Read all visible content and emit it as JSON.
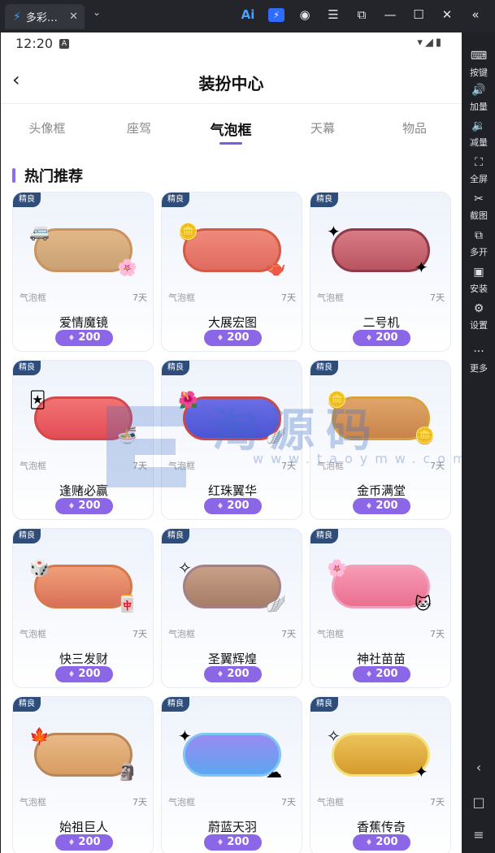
{
  "window": {
    "tab_title": "多彩…",
    "tab_close": "✕",
    "chevron": "⌄",
    "toolbar_icons": [
      "ai-icon",
      "bolt-icon",
      "user-icon",
      "menu-icon",
      "popout-icon",
      "minimize-icon",
      "maximize-icon",
      "close-icon",
      "collapse-icon"
    ]
  },
  "sidebar": {
    "items": [
      {
        "label": "按键",
        "icon": "keyboard-icon",
        "glyph": "⌨"
      },
      {
        "label": "加量",
        "icon": "volume-up-icon",
        "glyph": "🔊"
      },
      {
        "label": "减量",
        "icon": "volume-down-icon",
        "glyph": "🔉"
      },
      {
        "label": "全屏",
        "icon": "fullscreen-icon",
        "glyph": "⛶"
      },
      {
        "label": "截图",
        "icon": "scissors-icon",
        "glyph": "✂"
      },
      {
        "label": "多开",
        "icon": "multi-open-icon",
        "glyph": "⧉"
      },
      {
        "label": "安装",
        "icon": "apk-install-icon",
        "glyph": "▣"
      },
      {
        "label": "设置",
        "icon": "settings-icon",
        "glyph": "⚙"
      },
      {
        "label": "更多",
        "icon": "more-icon",
        "glyph": "···"
      }
    ]
  },
  "status": {
    "time": "12:20",
    "a": "A"
  },
  "appbar": {
    "title": "装扮中心",
    "back": "‹"
  },
  "tabs": [
    "头像框",
    "座驾",
    "气泡框",
    "天幕",
    "物品"
  ],
  "active_tab": 2,
  "section_title": "热门推荐",
  "cards": [
    {
      "badge": "精良",
      "kind": "气泡框",
      "days": "7天",
      "name": "爱情魔镜",
      "price": "200",
      "colors": [
        "#e2b788",
        "#c9a173"
      ],
      "border": "#c9925f"
    },
    {
      "badge": "精良",
      "kind": "气泡框",
      "days": "7天",
      "name": "大展宏图",
      "price": "200",
      "colors": [
        "#f08a7a",
        "#e06a60"
      ],
      "border": "#d45a45"
    },
    {
      "badge": "精良",
      "kind": "气泡框",
      "days": "7天",
      "name": "二号机",
      "price": "200",
      "colors": [
        "#d97b86",
        "#b9545f"
      ],
      "border": "#8f3a47"
    },
    {
      "badge": "精良",
      "kind": "气泡框",
      "days": "7天",
      "name": "逢赌必赢",
      "price": "200",
      "colors": [
        "#f27373",
        "#e24d55"
      ],
      "border": "#d44a4a"
    },
    {
      "badge": "精良",
      "kind": "气泡框",
      "days": "7天",
      "name": "红珠翼华",
      "price": "200",
      "colors": [
        "#6a6ee6",
        "#4b55d3"
      ],
      "border": "#c84a4a"
    },
    {
      "badge": "精良",
      "kind": "气泡框",
      "days": "7天",
      "name": "金币满堂",
      "price": "200",
      "colors": [
        "#e0a56a",
        "#c9844a"
      ],
      "border": "#d6a040"
    },
    {
      "badge": "精良",
      "kind": "气泡框",
      "days": "7天",
      "name": "快三发财",
      "price": "200",
      "colors": [
        "#f0a078",
        "#d9705a"
      ],
      "border": "#d47a48"
    },
    {
      "badge": "精良",
      "kind": "气泡框",
      "days": "7天",
      "name": "圣翼辉煌",
      "price": "200",
      "colors": [
        "#c8a088",
        "#a67d66"
      ],
      "border": "#a48088"
    },
    {
      "badge": "精良",
      "kind": "气泡框",
      "days": "7天",
      "name": "神社苗苗",
      "price": "200",
      "colors": [
        "#f79ab3",
        "#ea6f90"
      ],
      "border": "#f0a0b8"
    },
    {
      "badge": "精良",
      "kind": "气泡框",
      "days": "7天",
      "name": "始祖巨人",
      "price": "200",
      "colors": [
        "#e9b985",
        "#d89d64"
      ],
      "border": "#b9865a"
    },
    {
      "badge": "精良",
      "kind": "气泡框",
      "days": "7天",
      "name": "蔚蓝天羽",
      "price": "200",
      "colors": [
        "#9a8af2",
        "#5ca6f0"
      ],
      "border": "#7ec6f5"
    },
    {
      "badge": "精良",
      "kind": "气泡框",
      "days": "7天",
      "name": "香蕉传奇",
      "price": "200",
      "colors": [
        "#ecc25a",
        "#d59b2d"
      ],
      "border": "#f3e27a"
    }
  ],
  "watermark": {
    "text": "淘源码",
    "url": "www.taoymw.com"
  }
}
